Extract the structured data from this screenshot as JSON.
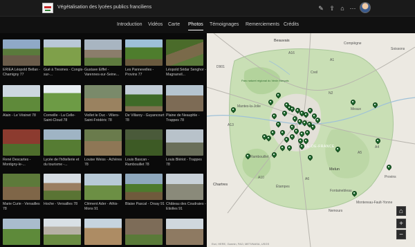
{
  "header": {
    "title": "Végétalisation des lycées publics franciliens",
    "icons": [
      "edit-icon",
      "share-icon",
      "home-icon",
      "more-icon"
    ]
  },
  "nav": {
    "tabs": [
      {
        "label": "Introduction",
        "active": false
      },
      {
        "label": "Vidéos",
        "active": false
      },
      {
        "label": "Carte",
        "active": false
      },
      {
        "label": "Photos",
        "active": true
      },
      {
        "label": "Témoignages",
        "active": false
      },
      {
        "label": "Remerciements",
        "active": false
      },
      {
        "label": "Crédits",
        "active": false
      }
    ]
  },
  "gallery": {
    "items": [
      "ERIEA Léopold Bellan - Chamigny 77",
      "Gué à Tresmes - Congis-sur-...",
      "Gustave Eiffel - Varennes-sur-Seine...",
      "Les Pannevelles - Provins 77",
      "Léopold Sédar Senghor - Magnanvil...",
      "Alain - Le Vésinet 78",
      "Corneille - La Celle-Saint-Cloud 78",
      "Viollet le Duc - Villers-Saint-Frédéric 78",
      "De Villaroy - Guyancourt 78",
      "Plaine de Neauphle - Trappes 78",
      "René Descartes - Montigny-le-...",
      "Lycée de l'hôtellerie et du tourisme -...",
      "Louise Weiss - Achères 78",
      "Louis Bascan - Rambouillet 78",
      "Louis Blériot - Trappes 78",
      "Marie Curie - Versailles 78",
      "Hoche - Versailles 78",
      "Clément Ader - Athis-Mons 91",
      "Blaise Pascal - Orsay 91",
      "Château des Coudraies - Etiolles 91",
      "",
      "",
      "",
      "",
      ""
    ]
  },
  "map": {
    "places": [
      "Beauvais",
      "Compiègne",
      "Soissons",
      "Creil",
      "Mantes-la-Jolie",
      "Meaux",
      "Rambouillet",
      "Melun",
      "Chartres",
      "Étampes",
      "Fontainebleau",
      "Nemours",
      "Provins",
      "Montereau-Fault-Yonne",
      "ÎLE-DE-FRANCE",
      "D901",
      "N2",
      "A16",
      "A1",
      "A4",
      "A5",
      "A6",
      "A10",
      "A13"
    ],
    "park_label": "Parc naturel régional du Vexin français",
    "zoom_in": "+",
    "zoom_out": "−",
    "home": "⌂",
    "attribution": "Esri, HERE, Garmin, FAO, METI/NASA, USGS"
  },
  "colors": {
    "background": "#0a0a0a",
    "topbar": "#1a1a1a",
    "marker": "#1f6b2e",
    "region_fill": "#c9dfb5"
  }
}
